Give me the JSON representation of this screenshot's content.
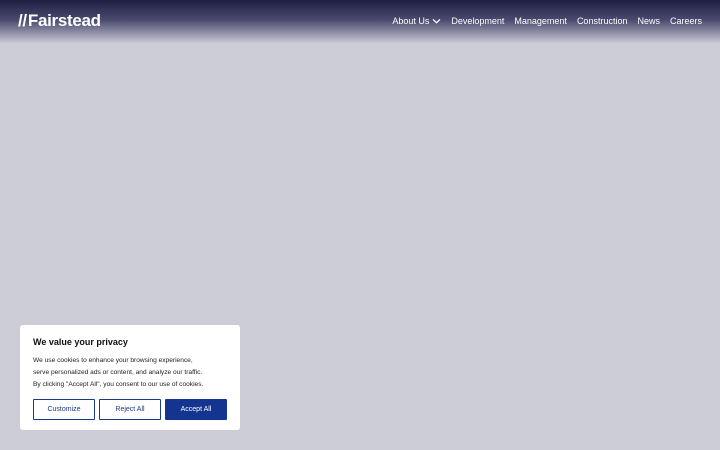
{
  "header": {
    "logo": {
      "mark": "//",
      "name": "Fairstead"
    },
    "nav": [
      {
        "label": "About Us",
        "icon": "chevron-down-icon"
      },
      {
        "label": "Development"
      },
      {
        "label": "Management"
      },
      {
        "label": "Construction"
      },
      {
        "label": "News"
      },
      {
        "label": "Careers"
      }
    ]
  },
  "cookie_banner": {
    "title": "We value your privacy",
    "lines": [
      "We use cookies to enhance your browsing experience,",
      "serve personalized ads or content, and analyze our traffic.",
      "By clicking \"Accept All\", you consent to our use of cookies."
    ],
    "buttons": {
      "customize": "Customize",
      "reject": "Reject All",
      "accept": "Accept All"
    }
  },
  "colors": {
    "page_background": "#cdcdd8",
    "header_top": "#1f1f45",
    "accent": "#14358f",
    "card_background": "#ffffff"
  }
}
